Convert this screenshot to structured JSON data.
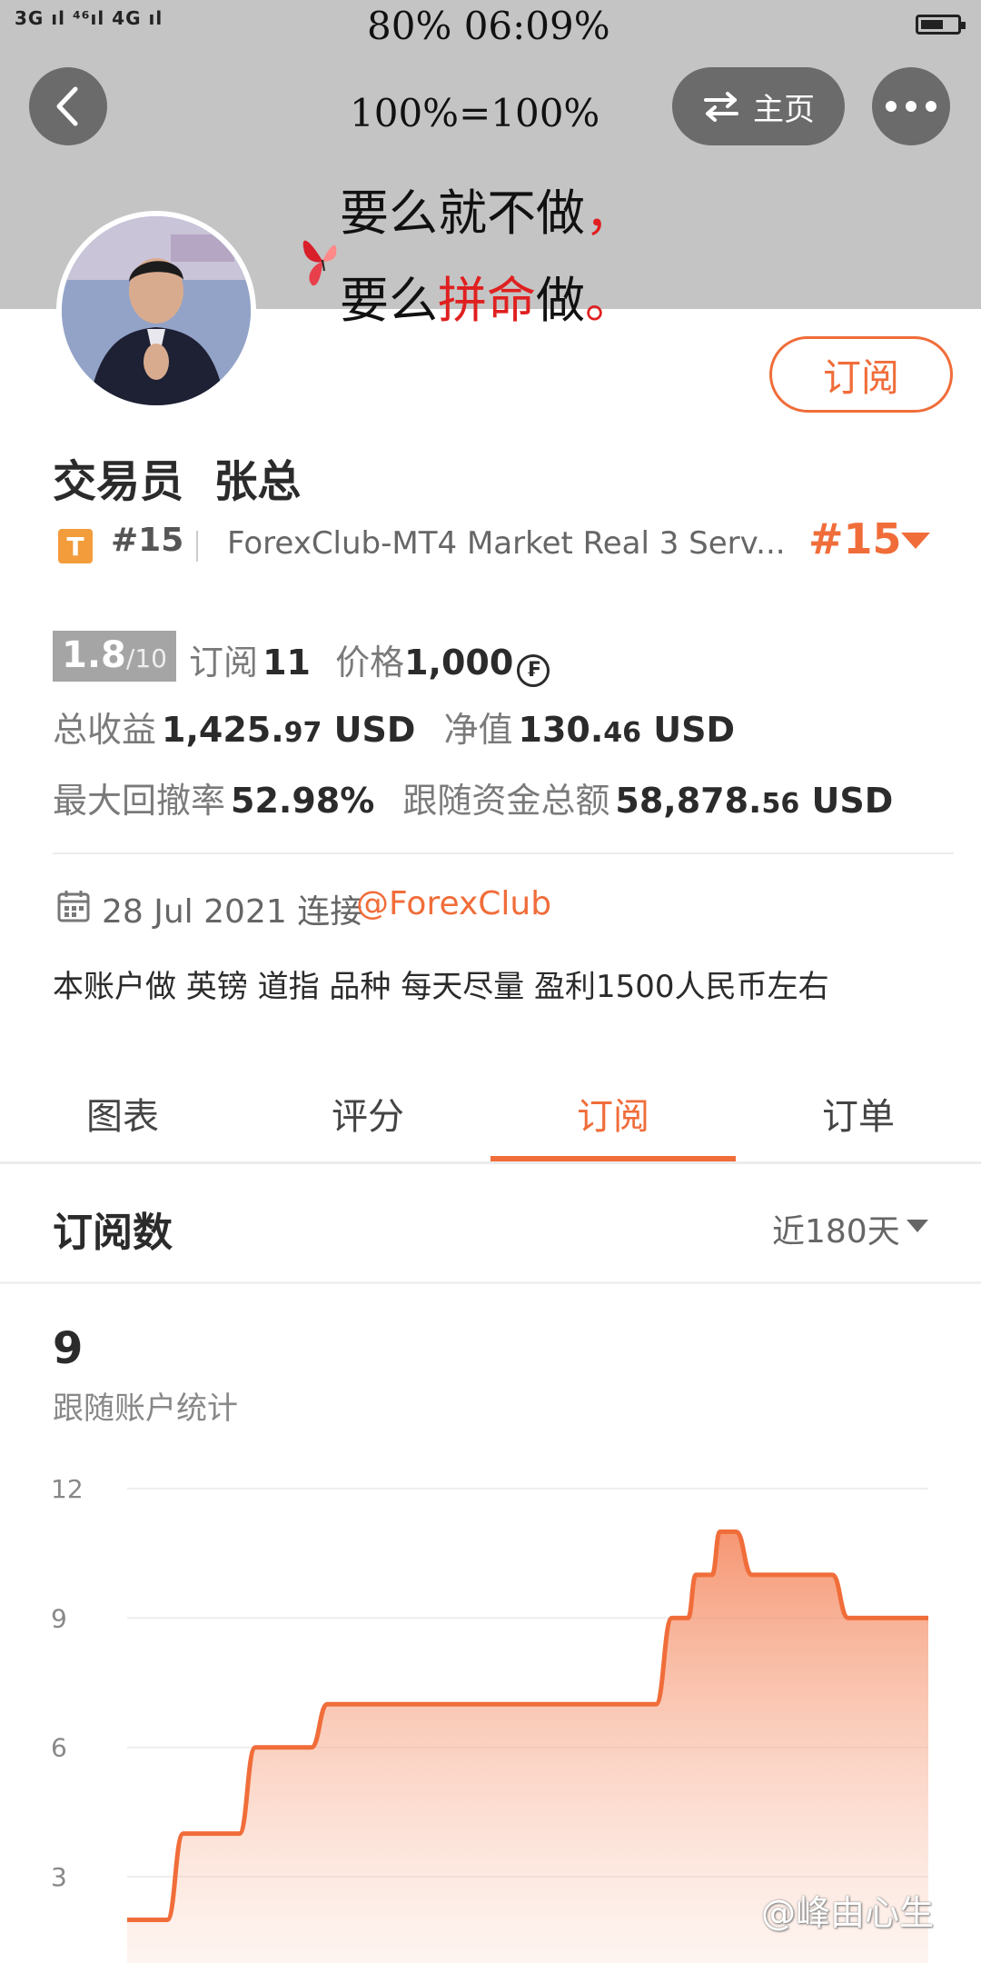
{
  "status_bar": {
    "left": "3G ıl ⁴⁶ıl 4G ıl"
  },
  "banner": {
    "top_text": "80% 06:09%",
    "line1": "100%=100%",
    "line2_a": "要么就不做",
    "line2_b": "，",
    "line3_a": "要么",
    "line3_b": "拼命",
    "line3_c": "做",
    "line3_d": "。"
  },
  "nav": {
    "home_label": "主页"
  },
  "profile": {
    "subscribe_label": "订阅",
    "name": "交易员  张总",
    "badge": "T",
    "rank_small": "#15",
    "server": "ForexClub-MT4 Market Real 3 Serv...",
    "rank_big": "#15"
  },
  "stats": {
    "score": "1.8",
    "score_max": "/10",
    "subs_label": "订阅",
    "subs_value": "11",
    "price_label": "价格",
    "price_value": "1,000",
    "coin_symbol": "₣",
    "income_label": "总收益",
    "income_int": "1,425.",
    "income_dec": "97",
    "income_unit": " USD",
    "equity_label": "净值",
    "equity_int": "130.",
    "equity_dec": "46",
    "equity_unit": " USD",
    "drawdown_label": "最大回撤率",
    "drawdown_value": "52.98%",
    "funds_label": "跟随资金总额",
    "funds_int": "58,878.",
    "funds_dec": "56",
    "funds_unit": " USD"
  },
  "info": {
    "date_text": "28 Jul 2021 连接",
    "broker": "@ForexClub",
    "description": "本账户做 英镑 道指 品种 每天尽量 盈利1500人民币左右"
  },
  "tabs": [
    {
      "label": "图表",
      "active": false
    },
    {
      "label": "评分",
      "active": false
    },
    {
      "label": "订阅",
      "active": true
    },
    {
      "label": "订单",
      "active": false
    }
  ],
  "section": {
    "title": "订阅数",
    "period": "近180天",
    "count": "9",
    "count_label": "跟随账户统计"
  },
  "chart_data": {
    "type": "area",
    "yticks": [
      "12",
      "9",
      "6",
      "3"
    ],
    "ylim": [
      1,
      12
    ],
    "x": [
      0,
      5,
      7,
      14,
      16,
      23,
      25,
      35,
      37,
      66,
      68,
      70,
      71,
      73,
      74,
      76,
      78,
      88,
      90,
      100
    ],
    "values": [
      2,
      2,
      4,
      4,
      6,
      6,
      7,
      7,
      7,
      7,
      9,
      9,
      10,
      10,
      11,
      11,
      10,
      10,
      9,
      9
    ],
    "color": "#f06d3a",
    "grid": true
  },
  "watermark": "@峰由心生",
  "colors": {
    "accent": "#f06d3a",
    "banner_bg": "#c4c4c4"
  }
}
